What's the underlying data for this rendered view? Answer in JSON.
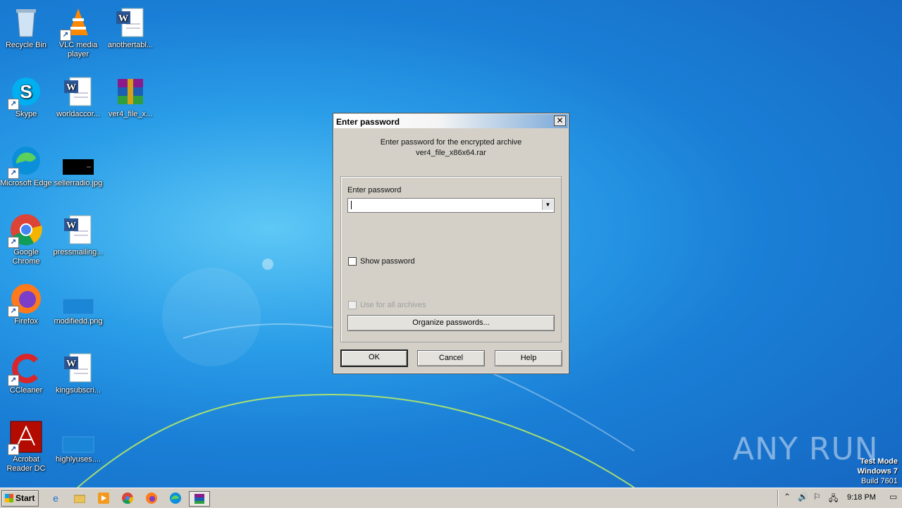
{
  "desktop_icons": [
    {
      "label": "Recycle Bin",
      "icon": "recycle-bin-icon"
    },
    {
      "label": "VLC media player",
      "icon": "vlc-icon"
    },
    {
      "label": "anothertabl...",
      "icon": "word-doc-icon"
    },
    {
      "label": "Skype",
      "icon": "skype-icon"
    },
    {
      "label": "worldaccor...",
      "icon": "word-doc-icon"
    },
    {
      "label": "ver4_file_x...",
      "icon": "winrar-archive-icon"
    },
    {
      "label": "Microsoft Edge",
      "icon": "edge-icon"
    },
    {
      "label": "sellerradio.jpg",
      "icon": "image-file-icon"
    },
    {
      "label": "Google Chrome",
      "icon": "chrome-icon"
    },
    {
      "label": "pressmailing...",
      "icon": "word-doc-icon"
    },
    {
      "label": "Firefox",
      "icon": "firefox-icon"
    },
    {
      "label": "modifiedd.png",
      "icon": "image-file-icon"
    },
    {
      "label": "CCleaner",
      "icon": "ccleaner-icon"
    },
    {
      "label": "kingsubscri...",
      "icon": "word-doc-icon"
    },
    {
      "label": "Acrobat Reader DC",
      "icon": "acrobat-icon"
    },
    {
      "label": "highlyuses....",
      "icon": "image-file-icon"
    }
  ],
  "dialog": {
    "title": "Enter password",
    "close_glyph": "✕",
    "message_line1": "Enter password for the encrypted archive",
    "message_line2": "ver4_file_x86x64.rar",
    "password_label": "Enter password",
    "password_value": "",
    "show_password_label": "Show password",
    "use_all_label": "Use for all archives",
    "organize_label": "Organize passwords...",
    "ok_label": "OK",
    "cancel_label": "Cancel",
    "help_label": "Help"
  },
  "taskbar": {
    "start_label": "Start",
    "clock": "9:18 PM",
    "pinned": [
      "internet-explorer-icon",
      "explorer-icon",
      "media-player-icon",
      "chrome-icon",
      "firefox-icon",
      "edge-icon",
      "winrar-icon"
    ]
  },
  "watermark": {
    "text": "ANY RUN",
    "line1": "Test Mode",
    "line2": "Windows 7",
    "line3": "Build 7601"
  }
}
